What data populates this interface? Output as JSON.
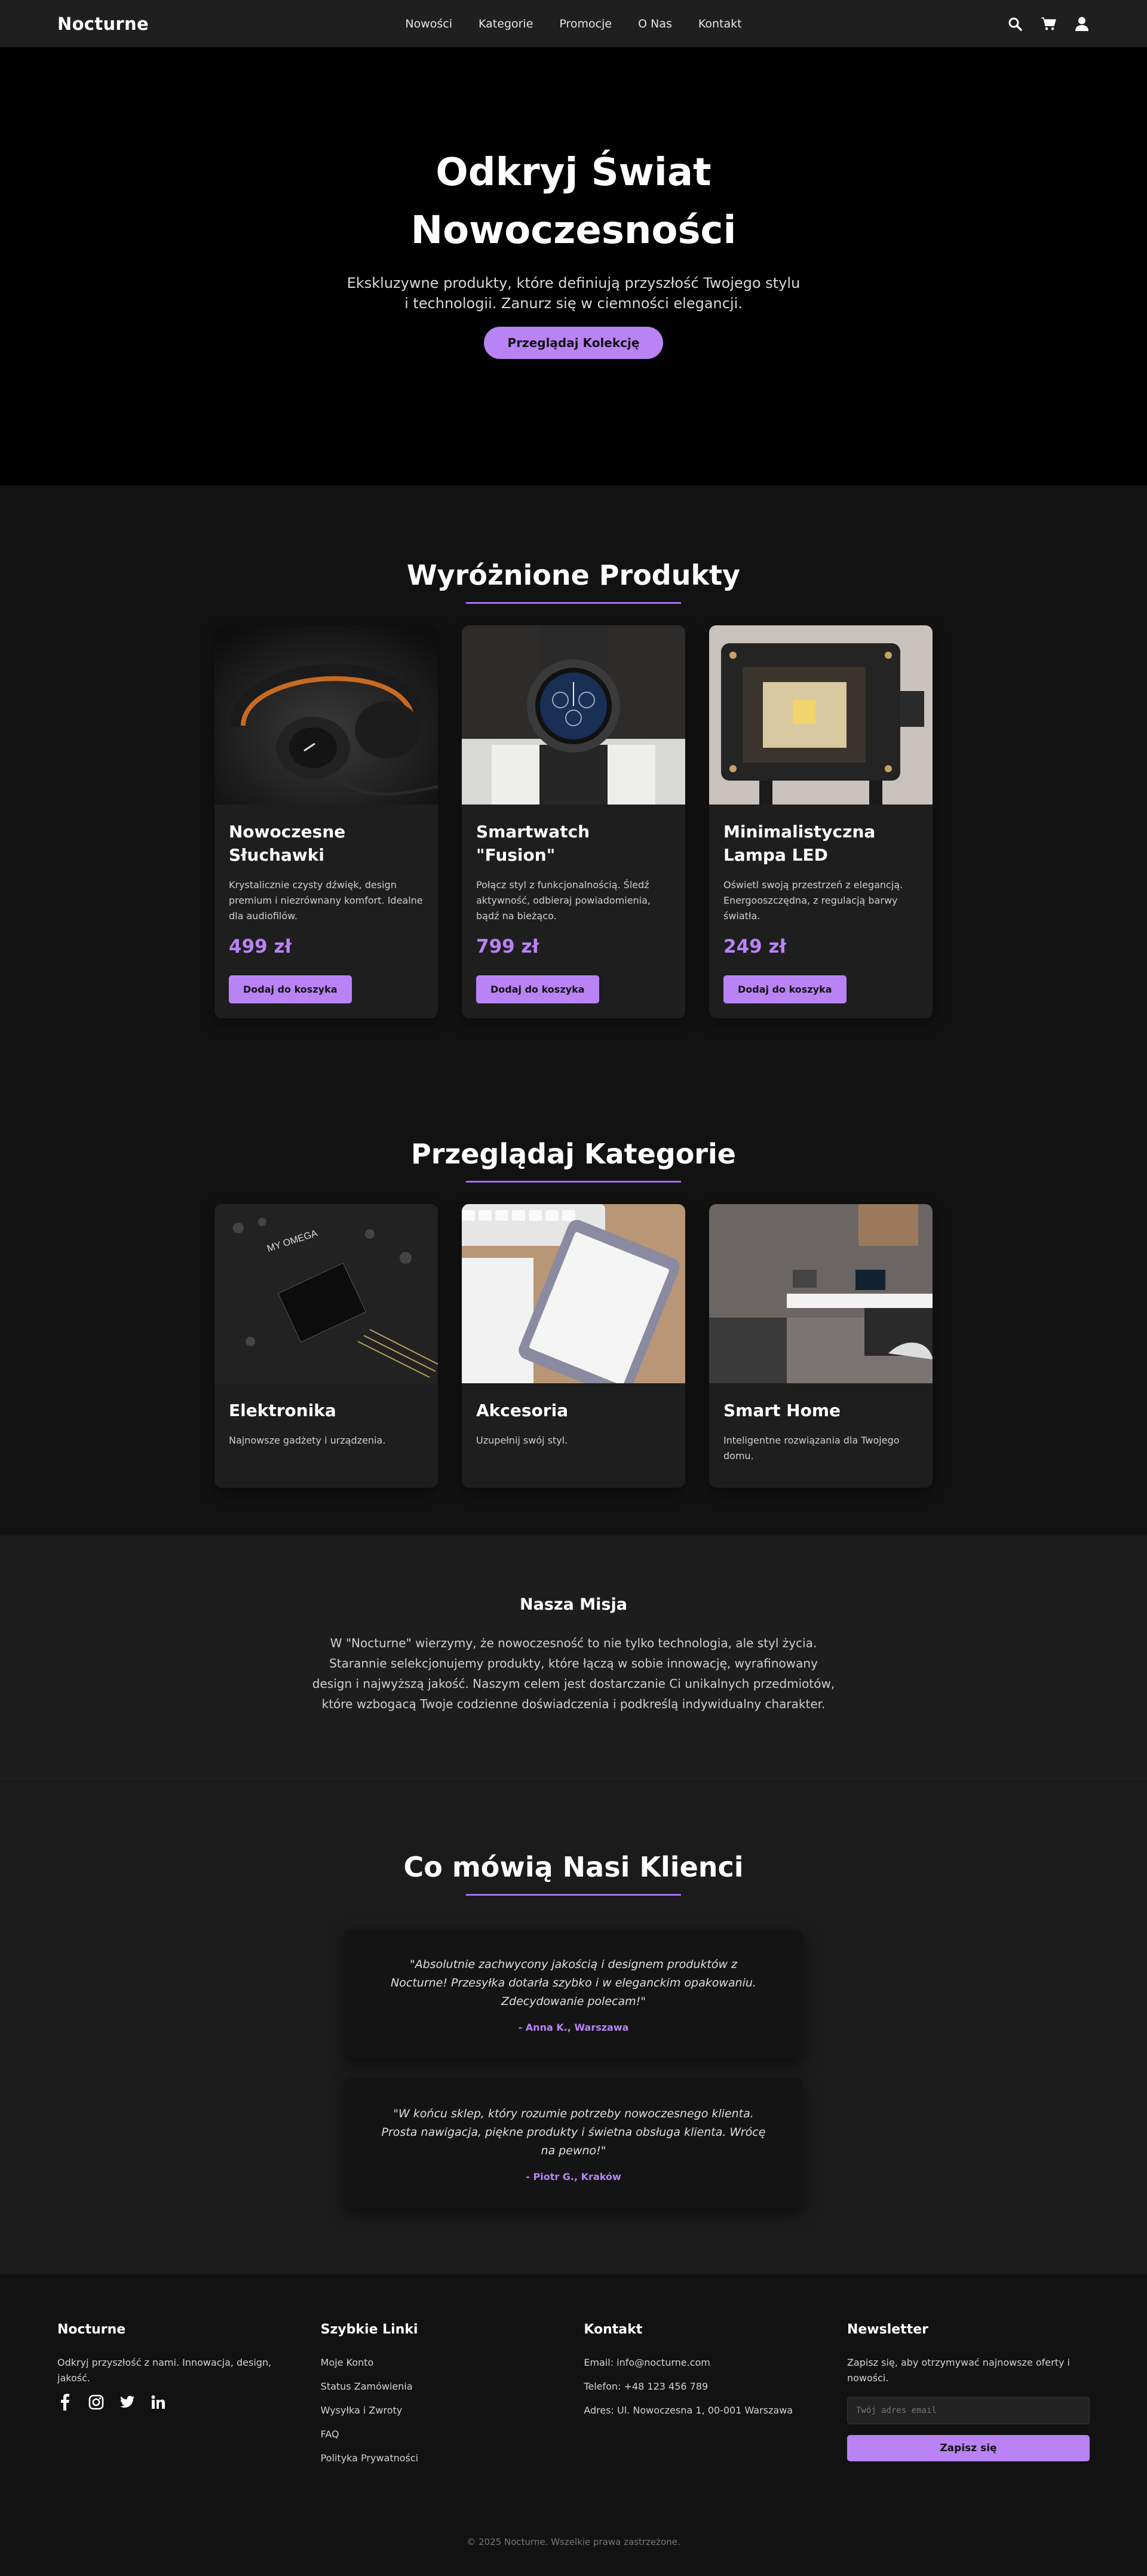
{
  "nav": {
    "logo": "Nocturne",
    "links": [
      "Nowości",
      "Kategorie",
      "Promocje",
      "O Nas",
      "Kontakt"
    ],
    "icons": [
      "search-icon",
      "cart-icon",
      "user-icon"
    ]
  },
  "hero": {
    "title": "Odkryj Świat Nowoczesności",
    "subtitle": "Ekskluzywne produkty, które definiują przyszłość Twojego stylu i technologii. Zanurz się w ciemności elegancji.",
    "cta": "Przeglądaj Kolekcję"
  },
  "featured": {
    "title": "Wyróżnione Produkty",
    "products": [
      {
        "name": "Nowoczesne Słuchawki",
        "desc": "Krystalicznie czysty dźwięk, design premium i niezrównany komfort. Idealne dla audiofilów.",
        "price": "499 zł",
        "button": "Dodaj do koszyka"
      },
      {
        "name": "Smartwatch \"Fusion\"",
        "desc": "Połącz styl z funkcjonalnością. Śledź aktywność, odbieraj powiadomienia, bądź na bieżąco.",
        "price": "799 zł",
        "button": "Dodaj do koszyka"
      },
      {
        "name": "Minimalistyczna Lampa LED",
        "desc": "Oświetl swoją przestrzeń z elegancją. Energooszczędna, z regulacją barwy światła.",
        "price": "249 zł",
        "button": "Dodaj do koszyka"
      }
    ]
  },
  "categories": {
    "title": "Przeglądaj Kategorie",
    "items": [
      {
        "name": "Elektronika",
        "desc": "Najnowsze gadżety i urządzenia."
      },
      {
        "name": "Akcesoria",
        "desc": "Uzupełnij swój styl."
      },
      {
        "name": "Smart Home",
        "desc": "Inteligentne rozwiązania dla Twojego domu."
      }
    ]
  },
  "mission": {
    "title": "Nasza Misja",
    "text": "W \"Nocturne\" wierzymy, że nowoczesność to nie tylko technologia, ale styl życia. Starannie selekcjonujemy produkty, które łączą w sobie innowację, wyrafinowany design i najwyższą jakość. Naszym celem jest dostarczanie Ci unikalnych przedmiotów, które wzbogacą Twoje codzienne doświadczenia i podkreślą indywidualny charakter."
  },
  "testimonials": {
    "title": "Co mówią Nasi Klienci",
    "items": [
      {
        "quote": "\"Absolutnie zachwycony jakością i designem produktów z Nocturne! Przesyłka dotarła szybko i w eleganckim opakowaniu. Zdecydowanie polecam!\"",
        "author": "- Anna K., Warszawa"
      },
      {
        "quote": "\"W końcu sklep, który rozumie potrzeby nowoczesnego klienta. Prosta nawigacja, piękne produkty i świetna obsługa klienta. Wrócę na pewno!\"",
        "author": "- Piotr G., Kraków"
      }
    ]
  },
  "footer": {
    "brand": {
      "title": "Nocturne",
      "text": "Odkryj przyszłość z nami. Innowacja, design, jakość.",
      "social": [
        "facebook-icon",
        "instagram-icon",
        "twitter-icon",
        "linkedin-icon"
      ]
    },
    "links": {
      "title": "Szybkie Linki",
      "items": [
        "Moje Konto",
        "Status Zamówienia",
        "Wysyłka i Zwroty",
        "FAQ",
        "Polityka Prywatności"
      ]
    },
    "contact": {
      "title": "Kontakt",
      "email": "Email: info@nocturne.com",
      "phone": "Telefon: +48 123 456 789",
      "address": "Adres: Ul. Nowoczesna 1, 00-001 Warszawa"
    },
    "newsletter": {
      "title": "Newsletter",
      "text": "Zapisz się, aby otrzymywać najnowsze oferty i nowości.",
      "placeholder": "Twój adres email",
      "button": "Zapisz się"
    },
    "copyright": "© 2025 Nocturne. Wszelkie prawa zastrzeżone."
  },
  "colors": {
    "accent": "#b983f5",
    "background": "#121212",
    "surface": "#1e1e1e"
  }
}
